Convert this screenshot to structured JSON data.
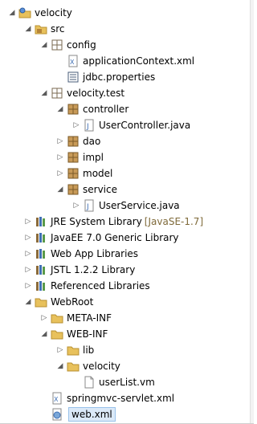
{
  "tree": {
    "nodes": [
      {
        "label": "velocity",
        "icon": "project-icon",
        "expanded": true
      },
      {
        "label": "src",
        "icon": "source-folder-icon",
        "expanded": true
      },
      {
        "label": "config",
        "icon": "package-icon",
        "expanded": true
      },
      {
        "label": "applicationContext.xml",
        "icon": "xml-file-icon"
      },
      {
        "label": "jdbc.properties",
        "icon": "properties-file-icon"
      },
      {
        "label": "velocity.test",
        "icon": "package-icon",
        "expanded": true
      },
      {
        "label": "controller",
        "icon": "package-icon",
        "expanded": true
      },
      {
        "label": "UserController.java",
        "icon": "java-file-icon",
        "expanded": false
      },
      {
        "label": "dao",
        "icon": "package-icon",
        "expanded": false
      },
      {
        "label": "impl",
        "icon": "package-icon",
        "expanded": false
      },
      {
        "label": "model",
        "icon": "package-icon",
        "expanded": false
      },
      {
        "label": "service",
        "icon": "package-icon",
        "expanded": true
      },
      {
        "label": "UserService.java",
        "icon": "java-file-icon",
        "expanded": false
      },
      {
        "label": "JRE System Library",
        "extra": "[JavaSE-1.7]",
        "icon": "library-icon",
        "expanded": false
      },
      {
        "label": "JavaEE 7.0 Generic Library",
        "icon": "library-icon",
        "expanded": false
      },
      {
        "label": "Web App Libraries",
        "icon": "library-icon",
        "expanded": false
      },
      {
        "label": "JSTL 1.2.2 Library",
        "icon": "library-icon",
        "expanded": false
      },
      {
        "label": "Referenced Libraries",
        "icon": "library-icon",
        "expanded": false
      },
      {
        "label": "WebRoot",
        "icon": "folder-icon",
        "expanded": true
      },
      {
        "label": "META-INF",
        "icon": "folder-icon",
        "expanded": false
      },
      {
        "label": "WEB-INF",
        "icon": "folder-icon",
        "expanded": true
      },
      {
        "label": "lib",
        "icon": "folder-icon",
        "expanded": false
      },
      {
        "label": "velocity",
        "icon": "folder-icon",
        "expanded": true
      },
      {
        "label": "userList.vm",
        "icon": "file-icon"
      },
      {
        "label": "springmvc-servlet.xml",
        "icon": "xml-file-icon"
      },
      {
        "label": "web.xml",
        "icon": "web-xml-file-icon",
        "selected": true
      }
    ]
  },
  "colors": {
    "folder": "#e8c15c",
    "package": "#b5843a",
    "java": "#3f6fb5",
    "selection": "#dbe9f8"
  }
}
